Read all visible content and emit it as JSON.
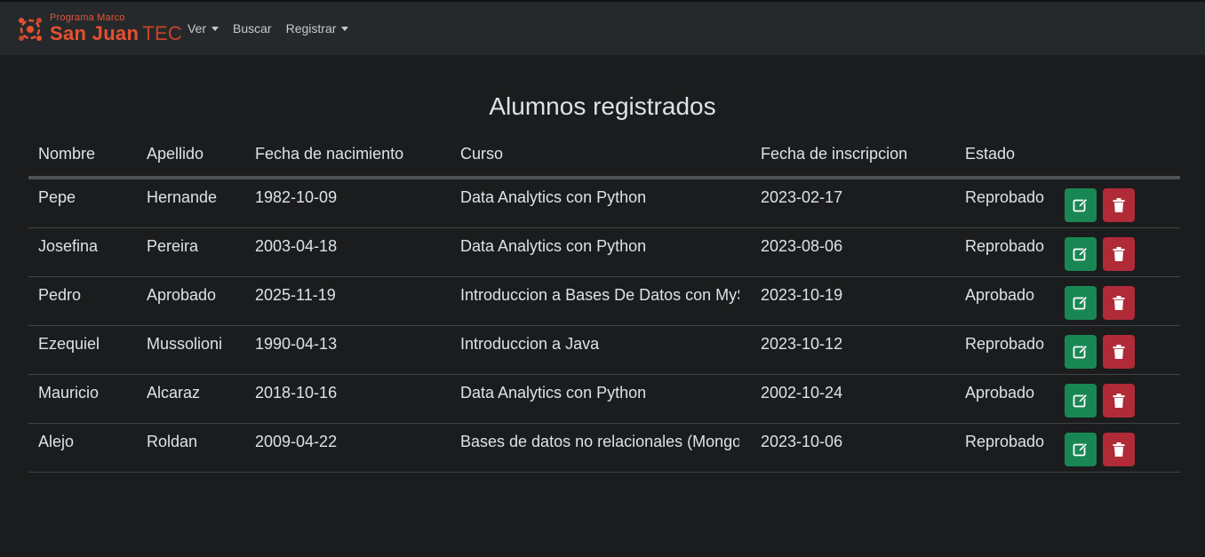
{
  "navbar": {
    "brand_small": "Programa Marco",
    "brand_main": "San Juan",
    "brand_tec": "TEC",
    "links": [
      {
        "label": "Ver",
        "dropdown": true
      },
      {
        "label": "Buscar",
        "dropdown": false
      },
      {
        "label": "Registrar",
        "dropdown": true
      }
    ]
  },
  "page_title": "Alumnos registrados",
  "table": {
    "headers": [
      "Nombre",
      "Apellido",
      "Fecha de nacimiento",
      "Curso",
      "Fecha de inscripcion",
      "Estado"
    ],
    "rows": [
      {
        "nombre": "Pepe",
        "apellido": "Hernande",
        "nacimiento": "1982-10-09",
        "curso": "Data Analytics con Python",
        "inscripcion": "2023-02-17",
        "estado": "Reprobado"
      },
      {
        "nombre": "Josefina",
        "apellido": "Pereira",
        "nacimiento": "2003-04-18",
        "curso": "Data Analytics con Python",
        "inscripcion": "2023-08-06",
        "estado": "Reprobado"
      },
      {
        "nombre": "Pedro",
        "apellido": "Aprobado",
        "nacimiento": "2025-11-19",
        "curso": "Introduccion a Bases De Datos con MyS",
        "inscripcion": "2023-10-19",
        "estado": "Aprobado"
      },
      {
        "nombre": "Ezequiel",
        "apellido": "Mussolioni",
        "nacimiento": "1990-04-13",
        "curso": "Introduccion a Java",
        "inscripcion": "2023-10-12",
        "estado": "Reprobado"
      },
      {
        "nombre": "Mauricio",
        "apellido": "Alcaraz",
        "nacimiento": "2018-10-16",
        "curso": "Data Analytics con Python",
        "inscripcion": "2002-10-24",
        "estado": "Aprobado"
      },
      {
        "nombre": "Alejo",
        "apellido": "Roldan",
        "nacimiento": "2009-04-22",
        "curso": "Bases de datos no relacionales (MongoI",
        "inscripcion": "2023-10-06",
        "estado": "Reprobado"
      }
    ]
  },
  "colors": {
    "edit_button": "#198754",
    "delete_button": "#b02a37",
    "brand": "#e8502f"
  },
  "icons": {
    "edit": "pencil-square-icon",
    "delete": "trash-icon"
  }
}
